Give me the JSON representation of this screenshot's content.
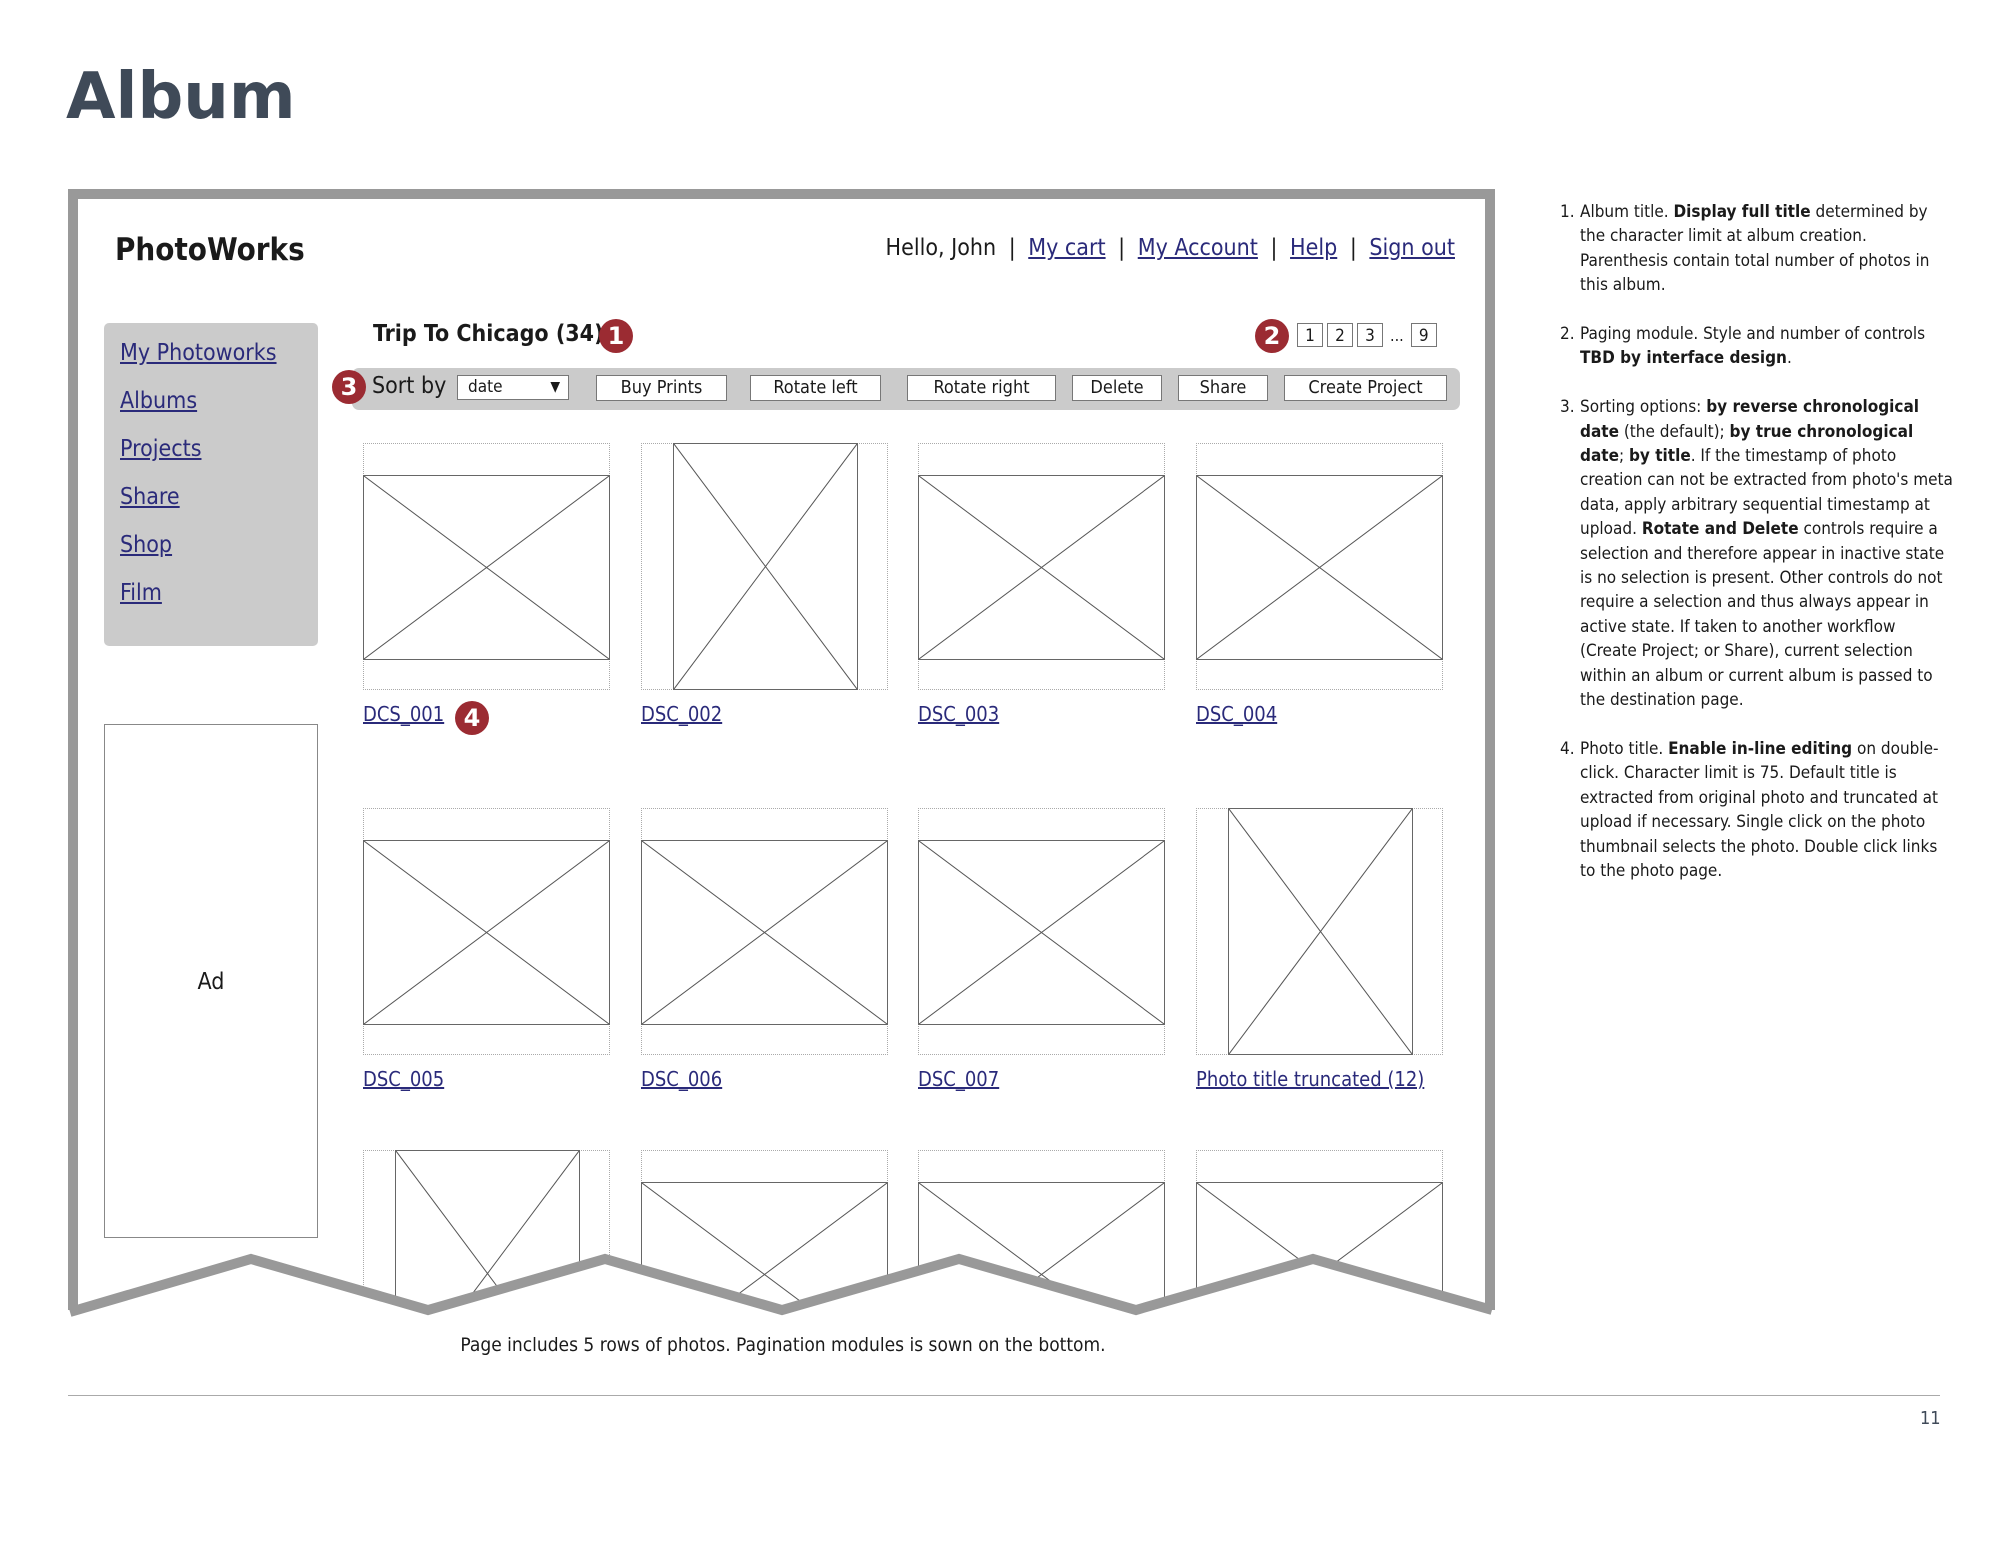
{
  "page": {
    "title": "Album",
    "footer_caption": "Page includes 5 rows of photos. Pagination modules is sown on the bottom.",
    "page_number": "11"
  },
  "app": {
    "logo": "PhotoWorks",
    "greeting": "Hello, John",
    "user_links": [
      "My cart",
      "My Account",
      "Help",
      "Sign out"
    ],
    "separator": "|",
    "sidebar": [
      "My Photoworks",
      "Albums",
      "Projects",
      "Share",
      "Shop",
      "Film"
    ],
    "ad_label": "Ad",
    "album_title": "Trip To Chicago (34)",
    "pager": {
      "pages": [
        "1",
        "2",
        "3"
      ],
      "ellipsis": "...",
      "last": "9"
    },
    "toolbar": {
      "sort_label": "Sort by",
      "sort_value": "date",
      "sort_caret": "▼",
      "buttons": [
        "Buy Prints",
        "Rotate left",
        "Rotate right",
        "Delete",
        "Share",
        "Create Project"
      ]
    },
    "photos": [
      {
        "title": "DCS_001",
        "orientation": "landscape"
      },
      {
        "title": "DSC_002",
        "orientation": "portrait"
      },
      {
        "title": "DSC_003",
        "orientation": "landscape"
      },
      {
        "title": "DSC_004",
        "orientation": "landscape"
      },
      {
        "title": "DSC_005",
        "orientation": "landscape"
      },
      {
        "title": "DSC_006",
        "orientation": "landscape"
      },
      {
        "title": "DSC_007",
        "orientation": "landscape"
      },
      {
        "title": "Photo title truncated (12)",
        "orientation": "portrait"
      },
      {
        "title": "",
        "orientation": "portrait"
      },
      {
        "title": "",
        "orientation": "landscape"
      },
      {
        "title": "",
        "orientation": "landscape"
      },
      {
        "title": "",
        "orientation": "landscape"
      }
    ],
    "badges": [
      "1",
      "2",
      "3",
      "4"
    ]
  },
  "colors": {
    "badge": "#9b2b32",
    "link": "#2a2a7a",
    "panel": "#cbcbcb",
    "frame": "#999999",
    "heading": "#3f4a58"
  },
  "notes": [
    {
      "num": "1.",
      "parts": [
        [
          "Album title. ",
          false
        ],
        [
          "Display full title",
          true
        ],
        [
          " determined by the character limit at album creation. Parenthesis contain total number of photos in this album.",
          false
        ]
      ]
    },
    {
      "num": "2.",
      "parts": [
        [
          "Paging module. Style and number of controls ",
          false
        ],
        [
          "TBD by interface design",
          true
        ],
        [
          ".",
          false
        ]
      ]
    },
    {
      "num": "3.",
      "parts": [
        [
          "Sorting options: ",
          false
        ],
        [
          "by reverse chronological date",
          true
        ],
        [
          " (the default); ",
          false
        ],
        [
          "by true chronological date",
          true
        ],
        [
          "; ",
          false
        ],
        [
          "by title",
          true
        ],
        [
          ". If the timestamp of photo creation can not be extracted from photo's meta data, apply arbitrary sequential timestamp at upload. ",
          false
        ],
        [
          "Rotate and Delete",
          true
        ],
        [
          " controls require a selection and therefore appear in inactive state is no selection is present. Other controls do not require a selection and thus always appear in active state. If taken to another workflow (Create Project; or Share), current selection within an album or current album is passed to the destination page.",
          false
        ]
      ]
    },
    {
      "num": "4.",
      "parts": [
        [
          "Photo title. ",
          false
        ],
        [
          "Enable in-line editing",
          true
        ],
        [
          " on double-click. Character limit is 75. Default title is extracted from original photo and truncated at upload if necessary. Single click on the photo thumbnail selects the photo. Double click links to the photo page.",
          false
        ]
      ]
    }
  ]
}
